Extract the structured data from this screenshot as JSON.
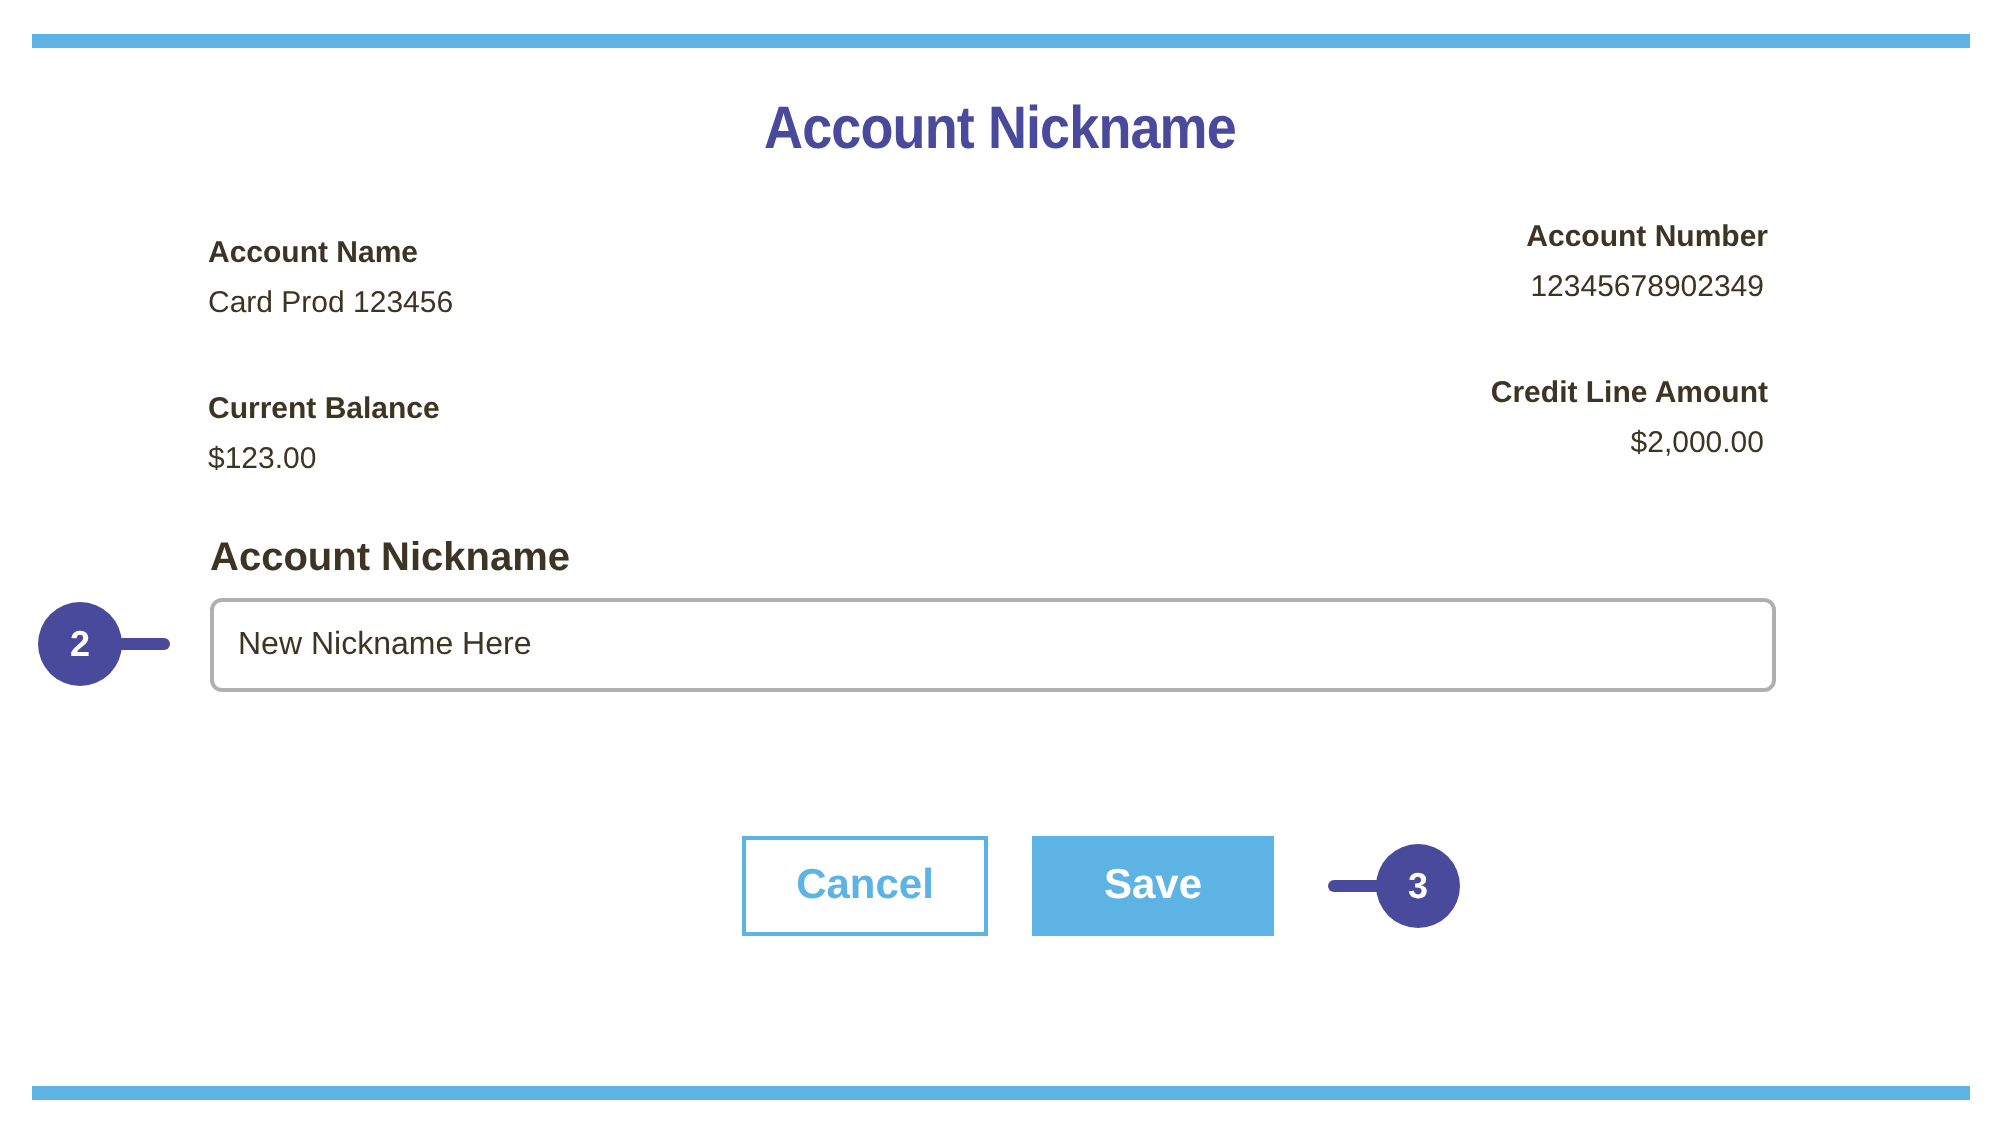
{
  "title": "Account Nickname",
  "fields": [
    {
      "label": "Account Name",
      "value": "Card Prod 123456"
    },
    {
      "label": "Account Number",
      "value": "12345678902349"
    },
    {
      "label": "Current Balance",
      "value": "$123.00"
    },
    {
      "label": "Credit Line Amount",
      "value": "$2,000.00"
    }
  ],
  "nickname": {
    "label": "Account Nickname",
    "value": "New Nickname Here"
  },
  "buttons": [
    {
      "label": "Cancel",
      "kind": "secondary"
    },
    {
      "label": "Save",
      "kind": "primary"
    }
  ],
  "callouts": [
    {
      "label": "2"
    },
    {
      "label": "3"
    }
  ]
}
